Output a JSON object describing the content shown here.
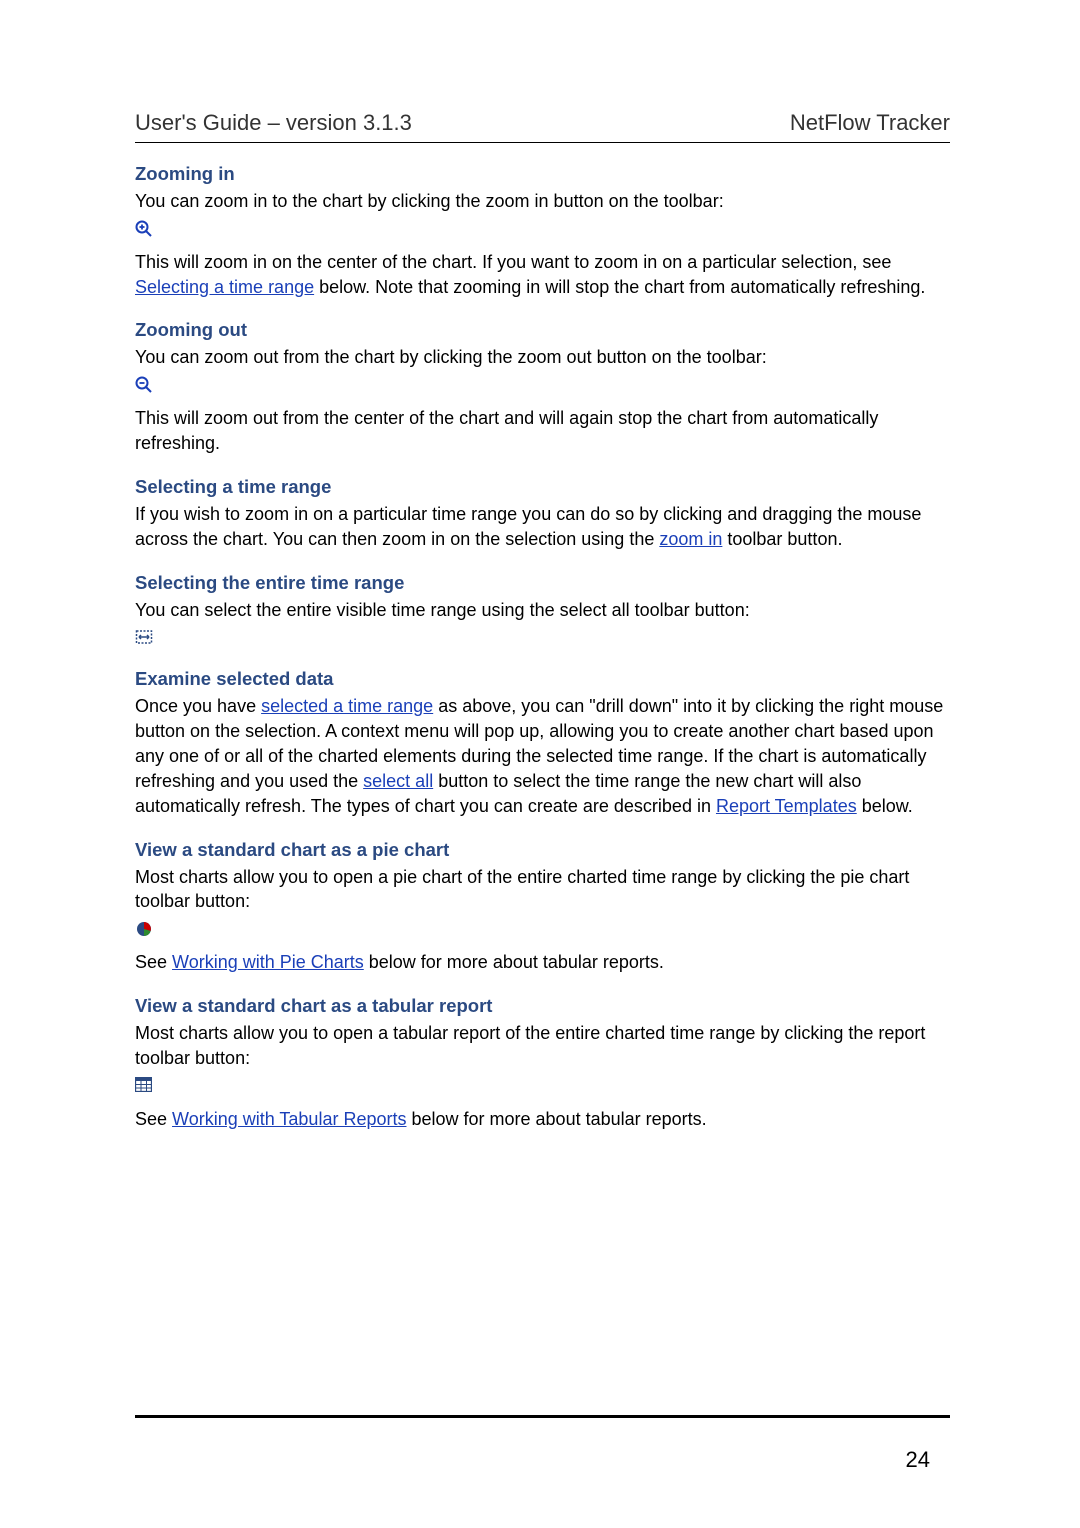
{
  "header": {
    "left": "User's Guide – version 3.1.3",
    "right": "NetFlow Tracker"
  },
  "sections": {
    "zoom_in": {
      "title": "Zooming in",
      "p1": "You can zoom in to the chart by clicking the zoom in button on the toolbar:",
      "p2a": "This will zoom in on the center of the chart. If you want to zoom in on a particular selection, see ",
      "p2_link": "Selecting a time range",
      "p2b": " below. Note that zooming in will stop the chart from automatically refreshing."
    },
    "zoom_out": {
      "title": "Zooming out",
      "p1": "You can zoom out from the chart by clicking the zoom out button on the toolbar:",
      "p2": "This will zoom out from the center of the chart and will again stop the chart from automatically refreshing."
    },
    "select_range": {
      "title": "Selecting a time range",
      "p1a": "If you wish to zoom in on a particular time range you can do so by clicking and dragging the mouse across the chart. You can then zoom in on the selection using the ",
      "p1_link": "zoom in",
      "p1b": " toolbar button."
    },
    "select_entire": {
      "title": "Selecting the entire time range",
      "p1": "You can select the entire visible time range using the select all toolbar button:"
    },
    "examine": {
      "title": "Examine selected data",
      "p1a": "Once you have ",
      "p1_link1": "selected a time range",
      "p1b": " as above, you can \"drill down\" into it by clicking the right mouse button on the selection. A context menu will pop up, allowing you to create another chart based upon any one of or all of the charted elements during the selected time range. If the chart is automatically refreshing and you used the ",
      "p1_link2": "select all",
      "p1c": " button to select the time range the new chart will also automatically refresh. The types of chart you can create are described in ",
      "p1_link3": "Report Templates",
      "p1d": " below."
    },
    "pie": {
      "title": "View a standard chart as a pie chart",
      "p1": "Most charts allow you to open a pie chart of the entire charted time range by clicking the pie chart toolbar button:",
      "p2a": "See ",
      "p2_link": "Working with Pie Charts",
      "p2b": " below for more about tabular reports."
    },
    "tabular": {
      "title": "View a standard chart as a tabular report",
      "p1": "Most charts allow you to open a tabular report of the entire charted time range by clicking the report toolbar button:",
      "p2a": "See ",
      "p2_link": "Working with Tabular Reports",
      "p2b": " below for more about tabular reports."
    }
  },
  "page_number": "24"
}
